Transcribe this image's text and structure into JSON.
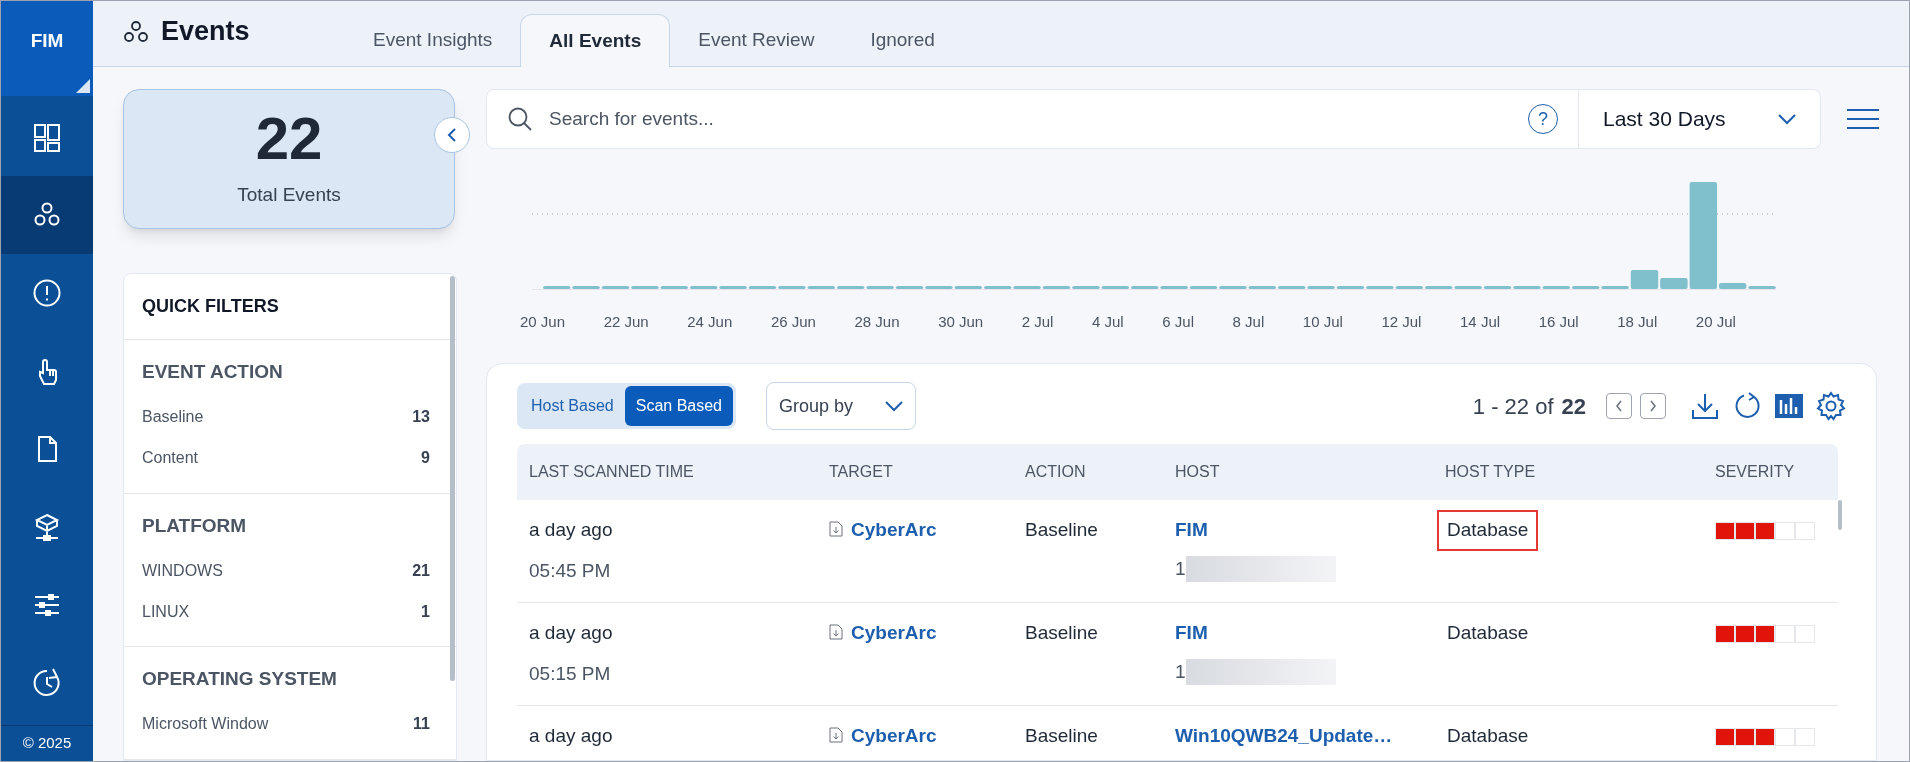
{
  "app": {
    "logo": "FIM",
    "copyright": "© 2025"
  },
  "sidebar": {
    "items": [
      {
        "kind": "dashboard",
        "selected": false
      },
      {
        "kind": "events",
        "selected": true
      },
      {
        "kind": "alert",
        "selected": false
      },
      {
        "kind": "touch",
        "selected": false
      },
      {
        "kind": "document",
        "selected": false
      },
      {
        "kind": "network",
        "selected": false
      },
      {
        "kind": "sliders",
        "selected": false
      },
      {
        "kind": "history",
        "selected": false
      }
    ]
  },
  "page": {
    "title": "Events"
  },
  "tabs": [
    {
      "label": "Event Insights",
      "selected": false
    },
    {
      "label": "All Events",
      "selected": true
    },
    {
      "label": "Event Review",
      "selected": false
    },
    {
      "label": "Ignored",
      "selected": false
    }
  ],
  "summary": {
    "count": "22",
    "label": "Total Events"
  },
  "quick_filters": {
    "title": "QUICK FILTERS",
    "groups": [
      {
        "title": "EVENT ACTION",
        "items": [
          {
            "label": "Baseline",
            "count": "13"
          },
          {
            "label": "Content",
            "count": "9"
          }
        ]
      },
      {
        "title": "PLATFORM",
        "items": [
          {
            "label": "WINDOWS",
            "count": "21"
          },
          {
            "label": "LINUX",
            "count": "1"
          }
        ]
      },
      {
        "title": "OPERATING SYSTEM",
        "items": [
          {
            "label": "Microsoft Window",
            "count": "11"
          }
        ]
      }
    ]
  },
  "search": {
    "placeholder": "Search for events...",
    "help": "?",
    "range": "Last 30 Days"
  },
  "chart": {
    "x_labels": [
      "20 Jun",
      "22 Jun",
      "24 Jun",
      "26 Jun",
      "28 Jun",
      "30 Jun",
      "2 Jul",
      "4 Jul",
      "6 Jul",
      "8 Jul",
      "10 Jul",
      "12 Jul",
      "14 Jul",
      "16 Jul",
      "18 Jul",
      "20 Jul"
    ]
  },
  "toolbar": {
    "modes": [
      {
        "label": "Host Based",
        "selected": false
      },
      {
        "label": "Scan Based",
        "selected": true
      }
    ],
    "group_by": "Group by",
    "range": "1 - 22 of",
    "total": "22"
  },
  "table": {
    "columns": [
      "LAST SCANNED TIME",
      "TARGET",
      "ACTION",
      "HOST",
      "HOST TYPE",
      "SEVERITY"
    ],
    "rows": [
      {
        "time": "a day ago",
        "clock": "05:45 PM",
        "target": "CyberArc",
        "action": "Baseline",
        "host": "FIM",
        "host_detail": "1",
        "host_type": "Database",
        "highlighted": true,
        "level": 0.6
      },
      {
        "time": "a day ago",
        "clock": "05:15 PM",
        "target": "CyberArc",
        "action": "Baseline",
        "host": "FIM",
        "host_detail": "1",
        "host_type": "Database",
        "highlighted": false,
        "level": 0.6
      },
      {
        "time": "a day ago",
        "target": "CyberArc",
        "action": "Baseline",
        "host": "Win10QWB24_Update…",
        "host_type": "Database",
        "highlighted": false,
        "level": 0.6
      }
    ]
  }
}
